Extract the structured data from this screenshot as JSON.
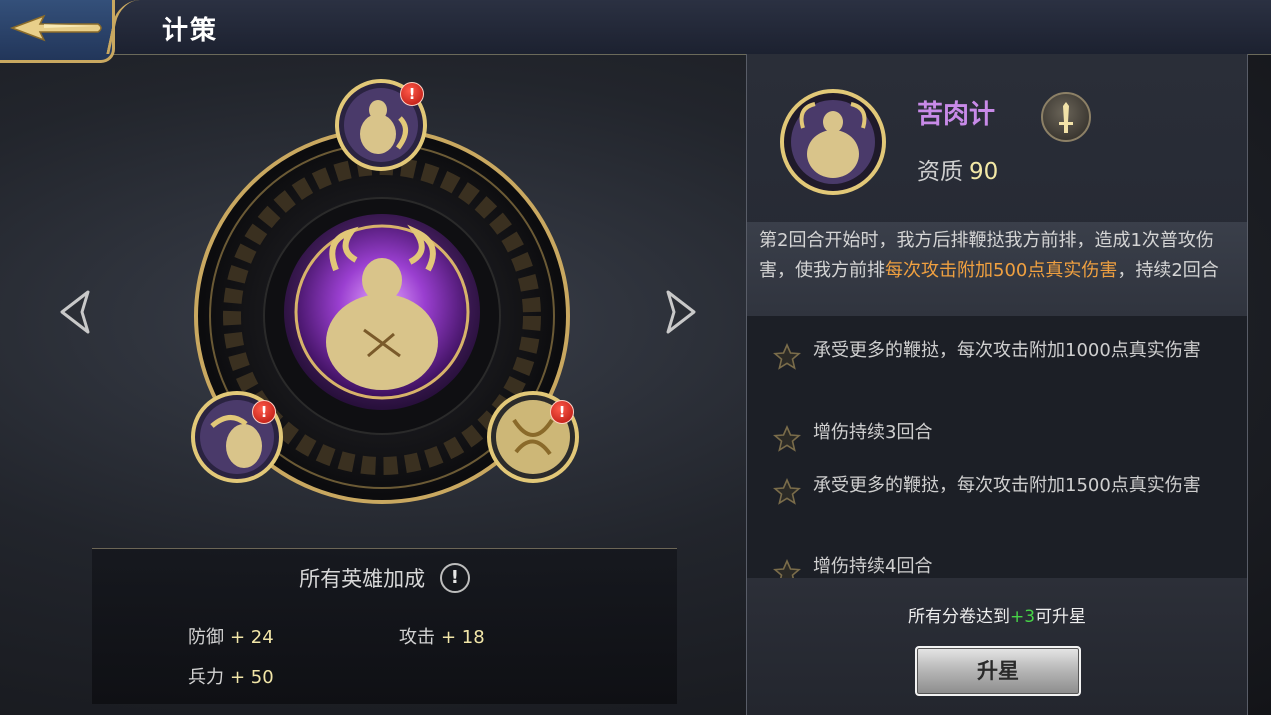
{
  "header": {
    "title": "计策"
  },
  "bonus": {
    "title": "所有英雄加成",
    "info_glyph": "!",
    "stats": [
      {
        "label": "防御",
        "value": "+ 24"
      },
      {
        "label": "攻击",
        "value": "+ 18"
      },
      {
        "label": "兵力",
        "value": "+ 50"
      }
    ]
  },
  "skill": {
    "name": "苦肉计",
    "quality_label": "资质",
    "quality_value": "90",
    "name_color": "#c88ae8"
  },
  "description": {
    "part1": "第2回合开始时，我方后排鞭挞我方前排，造成1次普攻伤害，使我方前排",
    "highlight": "每次攻击附加500点真实伤害",
    "part2": "，持续2回合",
    "highlight_color": "#f0a040"
  },
  "star_items": [
    "承受更多的鞭挞，每次攻击附加1000点真实伤害",
    "增伤持续3回合",
    "承受更多的鞭挞，每次攻击附加1500点真实伤害",
    "增伤持续4回合"
  ],
  "upgrade": {
    "requirement_prefix": "所有分卷达到",
    "requirement_value": "+3",
    "requirement_suffix": "可升星",
    "button_label": "升星"
  },
  "alert_glyph": "!",
  "icons": {
    "back": "back-arrow-icon",
    "prev": "prev-arrow-icon",
    "next": "next-arrow-icon",
    "equip": "sword-badge-icon",
    "star": "star-icon"
  }
}
